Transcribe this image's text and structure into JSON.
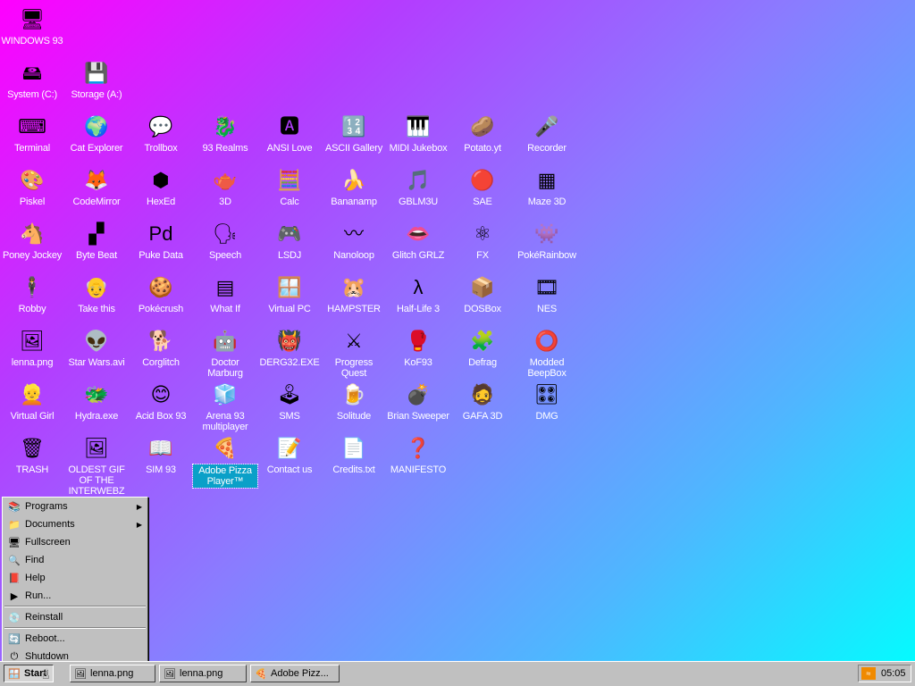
{
  "desktop": {
    "icons": [
      {
        "label": "WINDOWS 93",
        "glyph": "🖥",
        "col": 0,
        "row": 0
      },
      {
        "label": "System (C:)",
        "glyph": "🖴",
        "col": 0,
        "row": 1
      },
      {
        "label": "Storage (A:)",
        "glyph": "💾",
        "col": 1,
        "row": 1
      },
      {
        "label": "Terminal",
        "glyph": "⌨",
        "col": 0,
        "row": 2
      },
      {
        "label": "Cat Explorer",
        "glyph": "🌍",
        "col": 1,
        "row": 2
      },
      {
        "label": "Trollbox",
        "glyph": "💬",
        "col": 2,
        "row": 2
      },
      {
        "label": "93 Realms",
        "glyph": "🐉",
        "col": 3,
        "row": 2
      },
      {
        "label": "ANSI Love",
        "glyph": "🅰",
        "col": 4,
        "row": 2
      },
      {
        "label": "ASCII Gallery",
        "glyph": "🔢",
        "col": 5,
        "row": 2
      },
      {
        "label": "MIDI Jukebox",
        "glyph": "🎹",
        "col": 6,
        "row": 2
      },
      {
        "label": "Potato.yt",
        "glyph": "🥔",
        "col": 7,
        "row": 2
      },
      {
        "label": "Recorder",
        "glyph": "🎤",
        "col": 8,
        "row": 2
      },
      {
        "label": "Piskel",
        "glyph": "🎨",
        "col": 0,
        "row": 3
      },
      {
        "label": "CodeMirror",
        "glyph": "🦊",
        "col": 1,
        "row": 3
      },
      {
        "label": "HexEd",
        "glyph": "⬢",
        "col": 2,
        "row": 3
      },
      {
        "label": "3D",
        "glyph": "🫖",
        "col": 3,
        "row": 3
      },
      {
        "label": "Calc",
        "glyph": "🧮",
        "col": 4,
        "row": 3
      },
      {
        "label": "Bananamp",
        "glyph": "🍌",
        "col": 5,
        "row": 3
      },
      {
        "label": "GBLM3U",
        "glyph": "🎵",
        "col": 6,
        "row": 3
      },
      {
        "label": "SAE",
        "glyph": "🔴",
        "col": 7,
        "row": 3
      },
      {
        "label": "Maze 3D",
        "glyph": "▦",
        "col": 8,
        "row": 3
      },
      {
        "label": "Poney Jockey",
        "glyph": "🐴",
        "col": 0,
        "row": 4
      },
      {
        "label": "Byte Beat",
        "glyph": "▞",
        "col": 1,
        "row": 4
      },
      {
        "label": "Puke Data",
        "glyph": "Pd",
        "col": 2,
        "row": 4
      },
      {
        "label": "Speech",
        "glyph": "🗣",
        "col": 3,
        "row": 4
      },
      {
        "label": "LSDJ",
        "glyph": "🎮",
        "col": 4,
        "row": 4
      },
      {
        "label": "Nanoloop",
        "glyph": "〰",
        "col": 5,
        "row": 4
      },
      {
        "label": "Glitch GRLZ",
        "glyph": "👄",
        "col": 6,
        "row": 4
      },
      {
        "label": "FX",
        "glyph": "⚛",
        "col": 7,
        "row": 4
      },
      {
        "label": "PokéRainbow",
        "glyph": "👾",
        "col": 8,
        "row": 4
      },
      {
        "label": "Robby",
        "glyph": "🕴",
        "col": 0,
        "row": 5
      },
      {
        "label": "Take this",
        "glyph": "👴",
        "col": 1,
        "row": 5
      },
      {
        "label": "Pokécrush",
        "glyph": "🍪",
        "col": 2,
        "row": 5
      },
      {
        "label": "What If",
        "glyph": "▤",
        "col": 3,
        "row": 5
      },
      {
        "label": "Virtual PC",
        "glyph": "🪟",
        "col": 4,
        "row": 5
      },
      {
        "label": "HAMPSTER",
        "glyph": "🐹",
        "col": 5,
        "row": 5
      },
      {
        "label": "Half-Life 3",
        "glyph": "λ",
        "col": 6,
        "row": 5
      },
      {
        "label": "DOSBox",
        "glyph": "📦",
        "col": 7,
        "row": 5
      },
      {
        "label": "NES",
        "glyph": "🎞",
        "col": 8,
        "row": 5
      },
      {
        "label": "lenna.png",
        "glyph": "🖼",
        "col": 0,
        "row": 6
      },
      {
        "label": "Star Wars.avi",
        "glyph": "👽",
        "col": 1,
        "row": 6
      },
      {
        "label": "Corglitch",
        "glyph": "🐕",
        "col": 2,
        "row": 6
      },
      {
        "label": "Doctor Marburg",
        "glyph": "🤖",
        "col": 3,
        "row": 6
      },
      {
        "label": "DERG32.EXE",
        "glyph": "👹",
        "col": 4,
        "row": 6
      },
      {
        "label": "Progress Quest",
        "glyph": "⚔",
        "col": 5,
        "row": 6
      },
      {
        "label": "KoF93",
        "glyph": "🥊",
        "col": 6,
        "row": 6
      },
      {
        "label": "Defrag",
        "glyph": "🧩",
        "col": 7,
        "row": 6
      },
      {
        "label": "Modded BeepBox",
        "glyph": "⭕",
        "col": 8,
        "row": 6
      },
      {
        "label": "Virtual Girl",
        "glyph": "👱",
        "col": 0,
        "row": 7
      },
      {
        "label": "Hydra.exe",
        "glyph": "🐲",
        "col": 1,
        "row": 7
      },
      {
        "label": "Acid Box 93",
        "glyph": "😊",
        "col": 2,
        "row": 7
      },
      {
        "label": "Arena 93 multiplayer",
        "glyph": "🧊",
        "col": 3,
        "row": 7
      },
      {
        "label": "SMS",
        "glyph": "🕹",
        "col": 4,
        "row": 7
      },
      {
        "label": "Solitude",
        "glyph": "🍺",
        "col": 5,
        "row": 7
      },
      {
        "label": "Brian Sweeper",
        "glyph": "💣",
        "col": 6,
        "row": 7
      },
      {
        "label": "GAFA 3D",
        "glyph": "🧔",
        "col": 7,
        "row": 7
      },
      {
        "label": "DMG",
        "glyph": "🎛",
        "col": 8,
        "row": 7
      },
      {
        "label": "TRASH",
        "glyph": "🗑",
        "col": 0,
        "row": 8
      },
      {
        "label": "OLDEST GIF OF THE INTERWEBZ",
        "glyph": "🖼",
        "col": 1,
        "row": 8
      },
      {
        "label": "SIM 93",
        "glyph": "📖",
        "col": 2,
        "row": 8
      },
      {
        "label": "Adobe Pizza Player™",
        "glyph": "🍕",
        "col": 3,
        "row": 8,
        "selected": true
      },
      {
        "label": "Contact us",
        "glyph": "📝",
        "col": 4,
        "row": 8
      },
      {
        "label": "Credits.txt",
        "glyph": "📄",
        "col": 5,
        "row": 8
      },
      {
        "label": "MANIFESTO",
        "glyph": "❓",
        "col": 6,
        "row": 8
      }
    ]
  },
  "start_menu": {
    "items": [
      {
        "label": "Programs",
        "icon": "📚",
        "submenu": true
      },
      {
        "label": "Documents",
        "icon": "📁",
        "submenu": true
      },
      {
        "label": "Fullscreen",
        "icon": "🖥",
        "submenu": false
      },
      {
        "label": "Find",
        "icon": "🔍",
        "submenu": false
      },
      {
        "label": "Help",
        "icon": "📕",
        "submenu": false
      },
      {
        "label": "Run...",
        "icon": "▶",
        "submenu": false
      },
      {
        "separator": true
      },
      {
        "label": "Reinstall",
        "icon": "💿",
        "submenu": false
      },
      {
        "separator": true
      },
      {
        "label": "Reboot...",
        "icon": "🔄",
        "submenu": false
      },
      {
        "label": "Shutdown",
        "icon": "⏻",
        "submenu": false
      }
    ]
  },
  "taskbar": {
    "start_label": "Start",
    "tasks": [
      {
        "label": "lenna.png",
        "icon": "🖼"
      },
      {
        "label": "lenna.png",
        "icon": "🖼"
      },
      {
        "label": "Adobe Pizz...",
        "icon": "🍕"
      }
    ],
    "clock": "05:05",
    "tray_icon": "rss-icon"
  },
  "colors": {
    "selection": "#0aa0c8",
    "chrome": "#c0c0c0"
  }
}
